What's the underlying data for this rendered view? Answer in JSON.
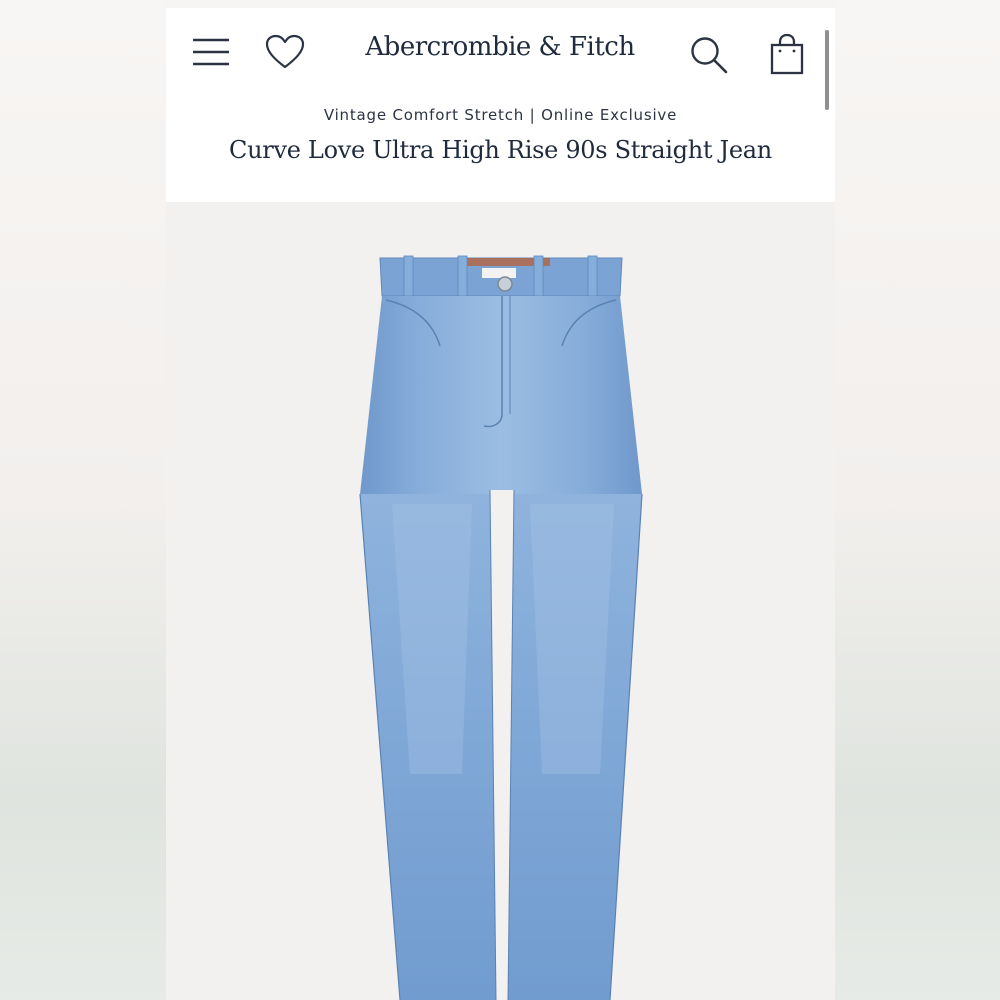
{
  "header": {
    "brand": "Abercrombie & Fitch",
    "menu_icon": "hamburger-menu-icon",
    "wishlist_icon": "heart-icon",
    "search_icon": "search-icon",
    "bag_icon": "shopping-bag-icon"
  },
  "product": {
    "subtitle": "Vintage Comfort Stretch | Online Exclusive",
    "title": "Curve Love Ultra High Rise 90s Straight Jean",
    "image_alt": "light-wash-straight-jeans"
  },
  "colors": {
    "brand_text": "#1f2b3d",
    "denim": "#7fa7d6",
    "denim_dark": "#6a93c7",
    "page_bg": "#ffffff",
    "image_bg": "#f2f1ef"
  }
}
